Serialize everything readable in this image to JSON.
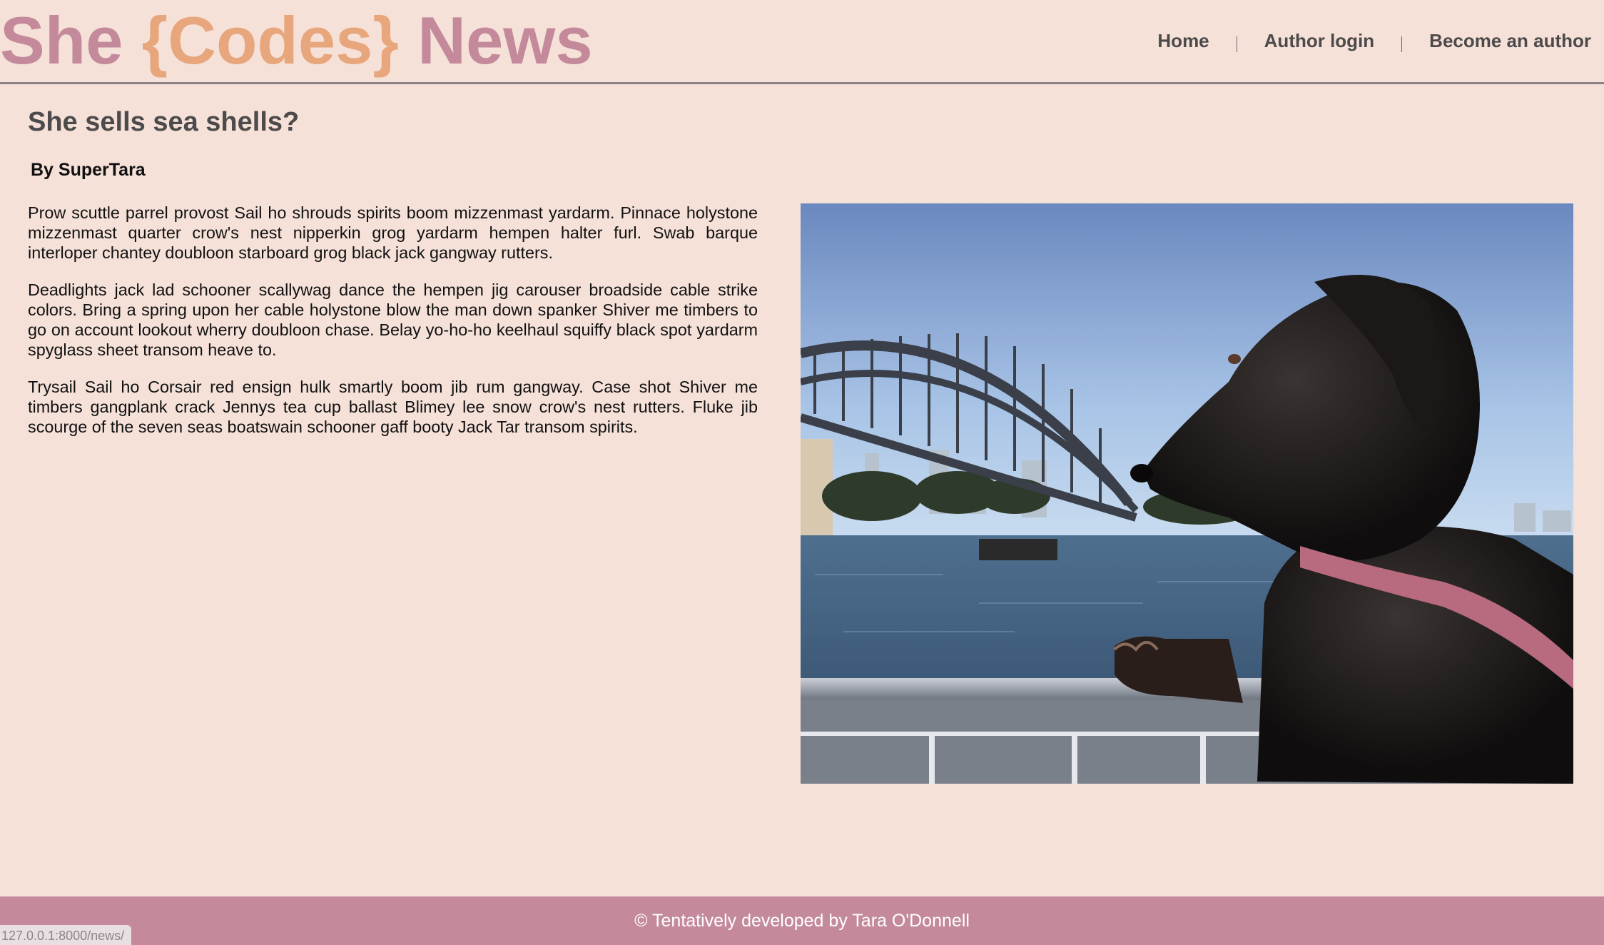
{
  "header": {
    "logo": {
      "part1": "She ",
      "part2": "{Codes}",
      "part3": " News"
    },
    "nav": [
      {
        "label": "Home"
      },
      {
        "label": "Author login"
      },
      {
        "label": "Become an author"
      }
    ]
  },
  "article": {
    "title": "She sells sea shells?",
    "byline": "By SuperTara",
    "paragraphs": [
      "Prow scuttle parrel provost Sail ho shrouds spirits boom mizzenmast yardarm. Pinnace holystone mizzenmast quarter crow's nest nipperkin grog yardarm hempen halter furl. Swab barque interloper chantey doubloon starboard grog black jack gangway rutters.",
      "Deadlights jack lad schooner scallywag dance the hempen jig carouser broadside cable strike colors. Bring a spring upon her cable holystone blow the man down spanker Shiver me timbers to go on account lookout wherry doubloon chase. Belay yo-ho-ho keelhaul squiffy black spot yardarm spyglass sheet transom heave to.",
      "Trysail Sail ho Corsair red ensign hulk smartly boom jib rum gangway. Case shot Shiver me timbers gangplank crack Jennys tea cup ballast Blimey lee snow crow's nest rutters. Fluke jib scourge of the seven seas boatswain schooner gaff booty Jack Tar transom spirits."
    ],
    "image": {
      "subject": "dog-on-ferry-harbour-bridge"
    }
  },
  "footer": {
    "text": "© Tentatively developed by Tara O'Donnell"
  },
  "status_bar": {
    "url": "127.0.0.1:8000/news/"
  },
  "colors": {
    "background": "#f5e1d8",
    "brand_pink": "#c48a9c",
    "brand_orange": "#e8a67d",
    "text_dark": "#4d4a4b"
  }
}
